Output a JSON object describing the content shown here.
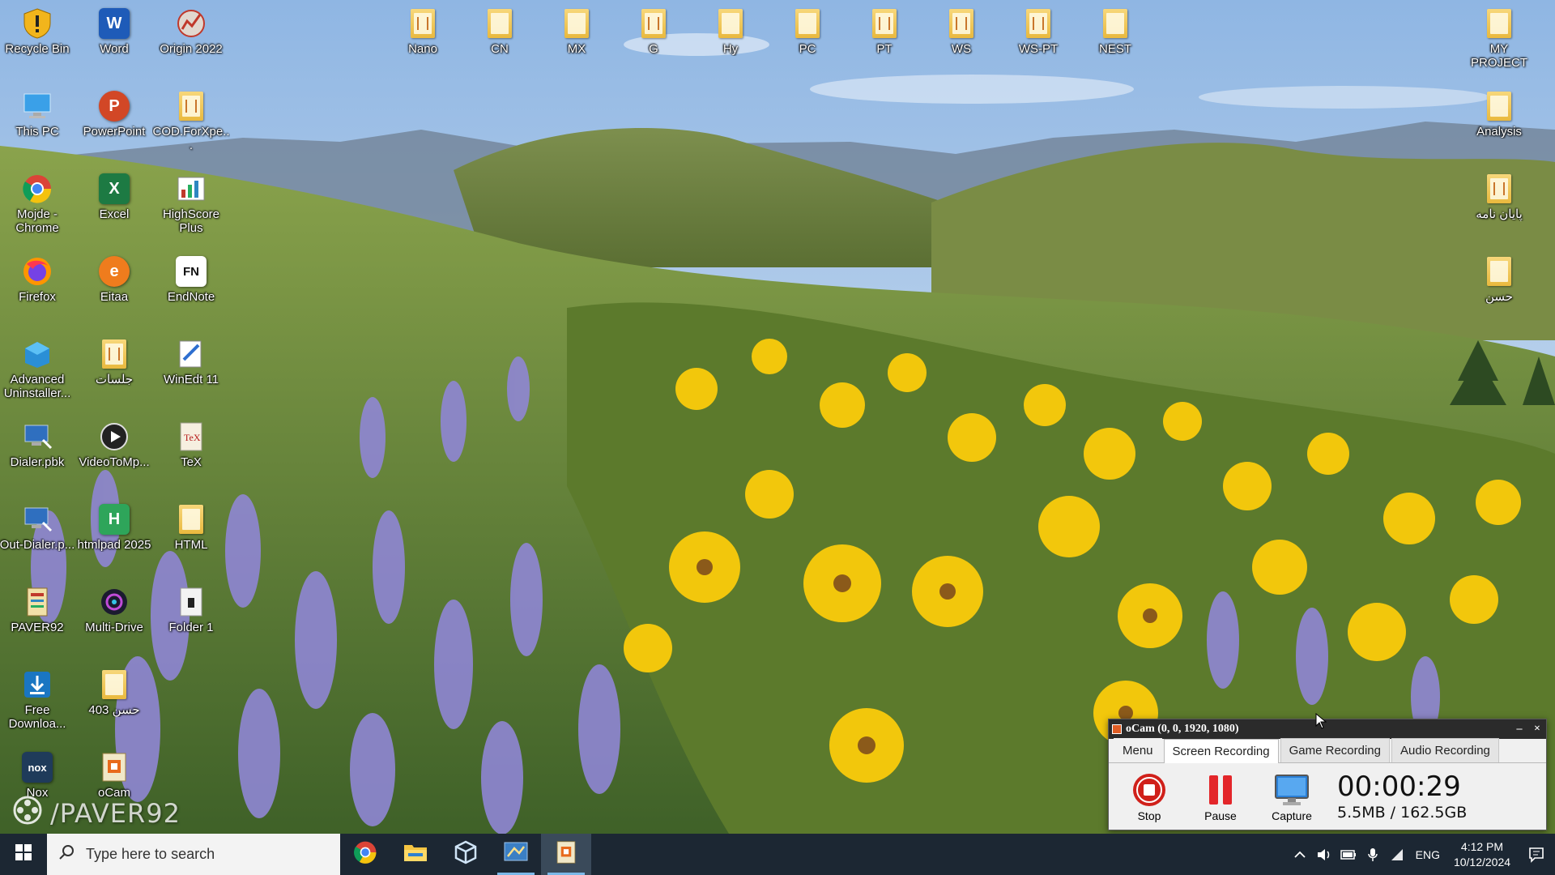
{
  "desktop": {
    "left_icons": [
      {
        "name": "recycle-bin-icon",
        "label": "Recycle Bin"
      },
      {
        "name": "word-icon",
        "label": "Word"
      },
      {
        "name": "origin-icon",
        "label": "Origin 2022"
      },
      {
        "name": "this-pc-icon",
        "label": "This PC"
      },
      {
        "name": "powerpoint-icon",
        "label": "PowerPoint"
      },
      {
        "name": "folder-icon",
        "label": "COD.ForXpe..."
      },
      {
        "name": "chrome-icon",
        "label": "Mojde - Chrome"
      },
      {
        "name": "excel-icon",
        "label": "Excel"
      },
      {
        "name": "highscore-icon",
        "label": "HighScore Plus"
      },
      {
        "name": "firefox-icon",
        "label": "Firefox"
      },
      {
        "name": "eitaa-icon",
        "label": "Eitaa"
      },
      {
        "name": "endnote-icon",
        "label": "EndNote"
      },
      {
        "name": "uninstaller-icon",
        "label": "Advanced Uninstaller..."
      },
      {
        "name": "folder-icon",
        "label": "جلسات"
      },
      {
        "name": "winedt-icon",
        "label": "WinEdt 11"
      },
      {
        "name": "dialer-icon",
        "label": "Dialer.pbk"
      },
      {
        "name": "video-icon",
        "label": "VideoToMp..."
      },
      {
        "name": "tex-icon",
        "label": "TeX"
      },
      {
        "name": "dialer-icon",
        "label": "Out-Dialer.p..."
      },
      {
        "name": "htmlpad-icon",
        "label": "htmlpad 2025"
      },
      {
        "name": "folder-icon",
        "label": "HTML"
      },
      {
        "name": "paver-icon",
        "label": "PAVER92"
      },
      {
        "name": "multidrive-icon",
        "label": "Multi-Drive"
      },
      {
        "name": "folder-lock-icon",
        "label": "Folder 1"
      },
      {
        "name": "download-icon",
        "label": "Free Downloa..."
      },
      {
        "name": "folder-icon",
        "label": "403 حسن"
      },
      {
        "name": "nox-icon",
        "label": "Nox"
      },
      {
        "name": "ocam-icon",
        "label": "oCam"
      }
    ],
    "top_folders": [
      "Nano",
      "CN",
      "MX",
      "G",
      "Hy",
      "PC",
      "PT",
      "WS",
      "WS-PT",
      "NEST"
    ],
    "right_folders": [
      "MY PROJECT",
      "Analysis",
      "پایان نامه",
      "حسن"
    ]
  },
  "watermark": "/PAVER92",
  "ocam": {
    "title": "oCam (0, 0, 1920, 1080)",
    "minimize": "–",
    "close": "×",
    "tabs": [
      "Menu",
      "Screen Recording",
      "Game Recording",
      "Audio Recording"
    ],
    "active_tab": "Screen Recording",
    "tools": {
      "stop": "Stop",
      "pause": "Pause",
      "capture": "Capture"
    },
    "timer": "00:00:29",
    "size": "5.5MB / 162.5GB"
  },
  "taskbar": {
    "search_placeholder": "Type here to search",
    "apps": [
      "chrome-icon",
      "file-explorer-icon",
      "box-app-icon",
      "app-icon",
      "ocam-icon"
    ],
    "tray": {
      "lang": "ENG",
      "time": "4:12 PM",
      "date": "10/12/2024"
    }
  },
  "colors": {
    "taskbar": "#1c2733",
    "accent": "#7ab8e8",
    "stop_red": "#d0201a"
  }
}
